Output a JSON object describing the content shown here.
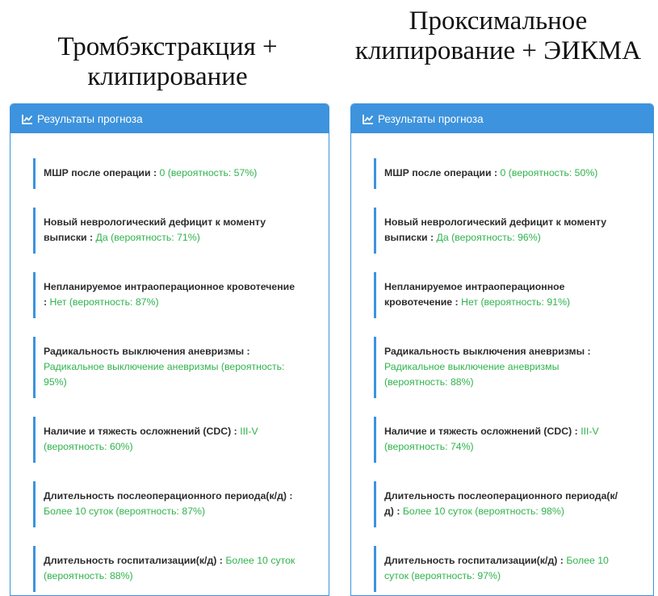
{
  "titles": {
    "left": "Тромбэкстракция + клипирование",
    "right": "Проксимальное клипирование + ЭИКМА"
  },
  "panel_header": "Результаты прогноза",
  "icons": {
    "header": "line-chart-icon"
  },
  "colors": {
    "accent": "#3d93dd",
    "value": "#2fb34d",
    "label": "#2d2d2d"
  },
  "left": {
    "items": [
      {
        "label": "МШР после операции :",
        "value": "0 (вероятность: 57%)"
      },
      {
        "label": "Новый неврологический дефицит к моменту выписки :",
        "value": "Да (вероятность: 71%)"
      },
      {
        "label": "Непланируемое интраоперационное кровотечение :",
        "value": "Нет (вероятность: 87%)"
      },
      {
        "label": "Радикальность выключения аневризмы :",
        "value": "Радикальное выключение аневризмы (вероятность: 95%)"
      },
      {
        "label": "Наличие и тяжесть осложнений (CDC) :",
        "value": "III-V (вероятность: 60%)"
      },
      {
        "label": "Длительность послеоперационного периода(к/д) :",
        "value": "Более 10 суток (вероятность: 87%)"
      },
      {
        "label": "Длительность госпитализации(к/д) :",
        "value": "Более 10 суток (вероятность: 88%)"
      }
    ]
  },
  "right": {
    "items": [
      {
        "label": "МШР после операции :",
        "value": "0 (вероятность: 50%)"
      },
      {
        "label": "Новый неврологический дефицит к моменту выписки :",
        "value": "Да (вероятность: 96%)"
      },
      {
        "label": "Непланируемое интраоперационное кровотечение :",
        "value": "Нет (вероятность: 91%)"
      },
      {
        "label": "Радикальность выключения аневризмы :",
        "value": "Радикальное выключение аневризмы (вероятность: 88%)"
      },
      {
        "label": "Наличие и тяжесть осложнений (CDC) :",
        "value": "III-V (вероятность: 74%)"
      },
      {
        "label": "Длительность послеоперационного периода(к/д) :",
        "value": "Более 10 суток (вероятность: 98%)"
      },
      {
        "label": "Длительность госпитализации(к/д) :",
        "value": "Более 10 суток (вероятность: 97%)"
      }
    ]
  }
}
